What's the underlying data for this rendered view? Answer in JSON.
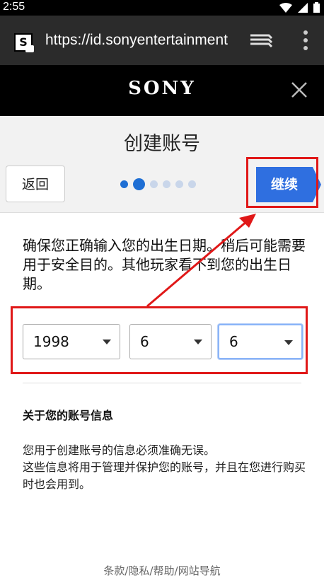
{
  "status_bar": {
    "time": "2:55"
  },
  "browser": {
    "url": "https://id.sonyentertainment",
    "site_icon_letter": "S"
  },
  "header": {
    "logo": "SONY"
  },
  "page": {
    "title": "创建账号",
    "back_label": "返回",
    "continue_label": "继续",
    "progress": {
      "total_steps": 6,
      "current_step": 2
    }
  },
  "instructions": "确保您正确输入您的出生日期。稍后可能需要用于安全目的。其他玩家看不到您的出生日期。",
  "birthdate": {
    "year": "1998",
    "month": "6",
    "day": "6"
  },
  "about": {
    "title": "关于您的账号信息",
    "line1": "您用于创建账号的信息必须准确无误。",
    "line2": "这些信息将用于管理并保护您的账号，并且在您进行购买时也会用到。"
  },
  "footer": "条款/隐私/帮助/网站导航",
  "colors": {
    "accent": "#2f6fe0",
    "annotation": "#e01818",
    "dot_inactive": "#c9d6ea"
  }
}
